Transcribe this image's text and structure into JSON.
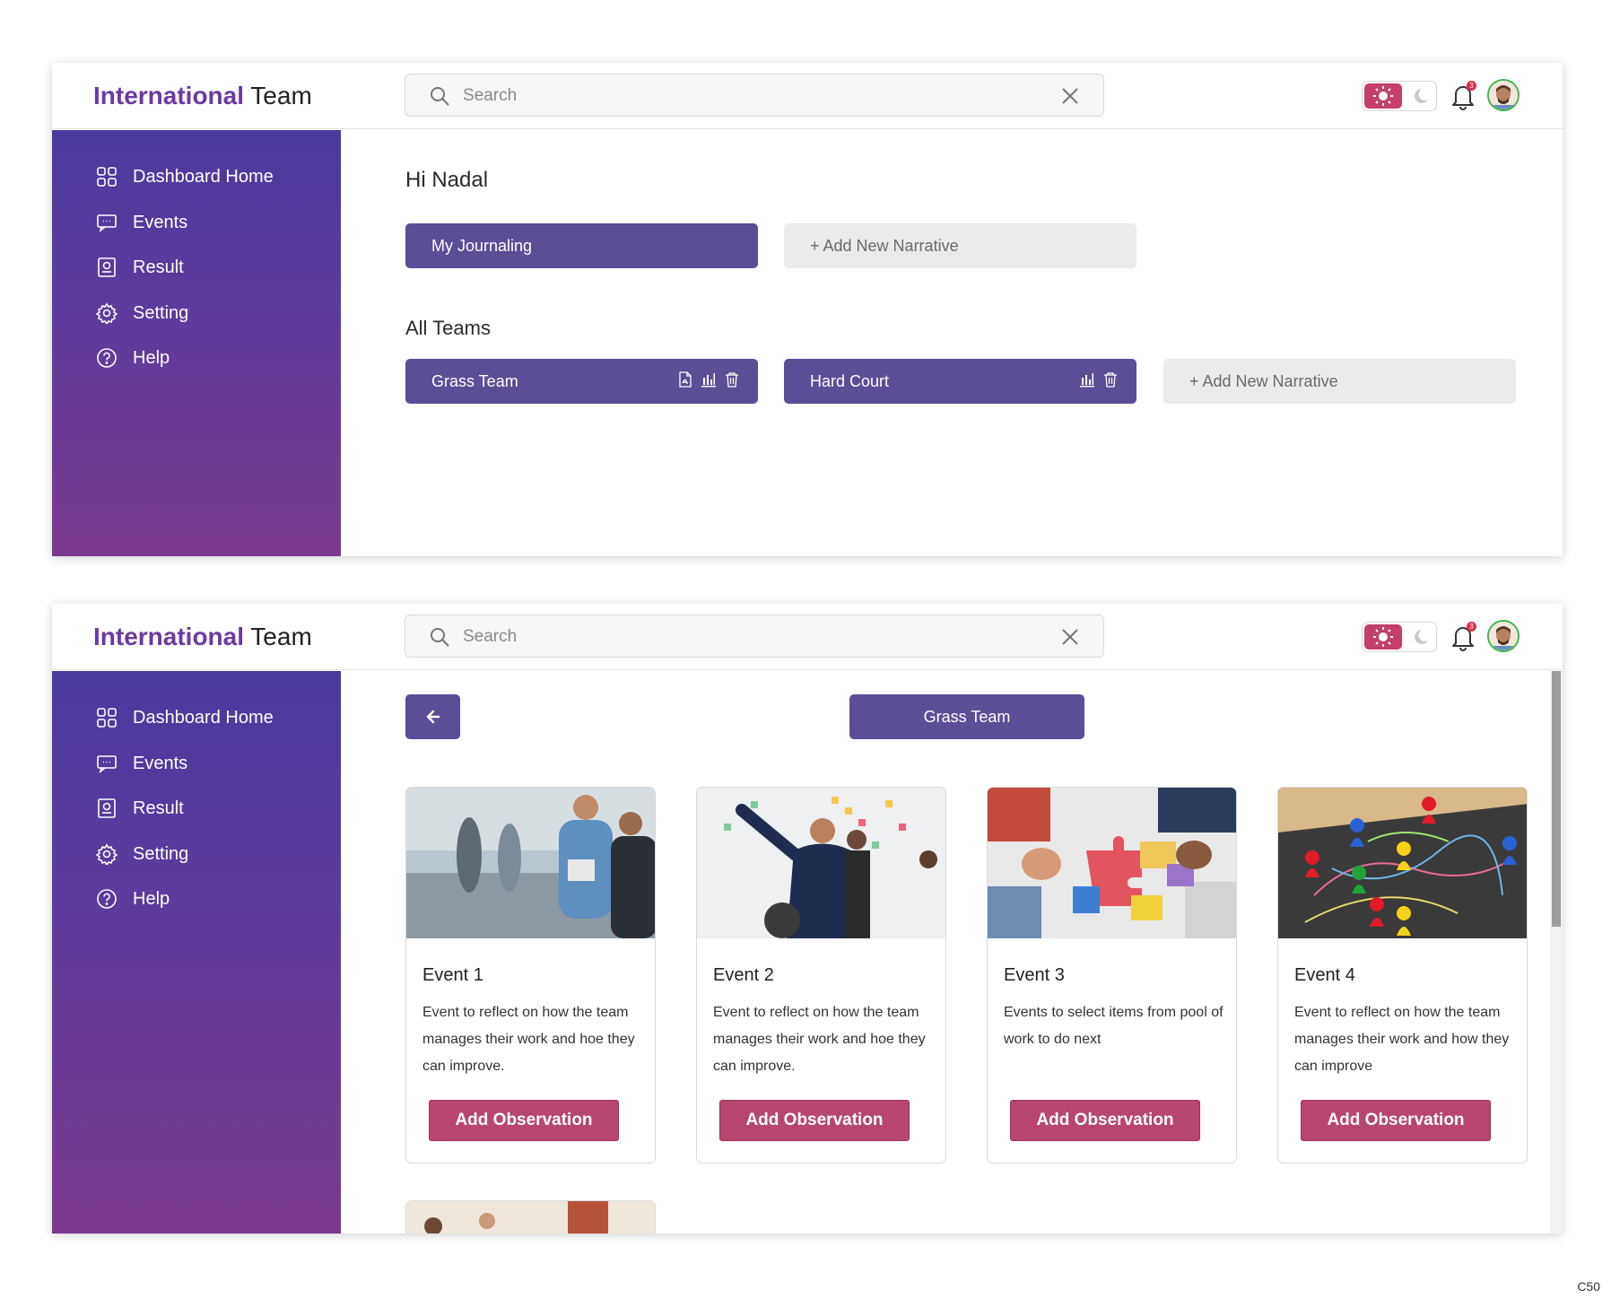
{
  "app": {
    "brand_part1": "International",
    "brand_part2": "Team"
  },
  "search": {
    "placeholder": "Search"
  },
  "topbar": {
    "notification_count": "3",
    "theme_mode": "light"
  },
  "sidebar": {
    "items": [
      {
        "label": "Dashboard Home",
        "icon": "grid-icon"
      },
      {
        "label": "Events",
        "icon": "chat-icon"
      },
      {
        "label": "Result",
        "icon": "report-icon"
      },
      {
        "label": "Setting",
        "icon": "gear-icon"
      },
      {
        "label": "Help",
        "icon": "help-icon"
      }
    ]
  },
  "dashboard": {
    "greeting": "Hi Nadal",
    "journal_button": "My Journaling",
    "add_narrative": "+ Add New Narrative",
    "all_teams_title": "All Teams",
    "teams": [
      {
        "name": "Grass Team",
        "actions": [
          "pdf-icon",
          "chart-icon",
          "trash-icon"
        ]
      },
      {
        "name": "Hard Court",
        "actions": [
          "chart-icon",
          "trash-icon"
        ]
      }
    ],
    "add_team_narrative": "+ Add New Narrative"
  },
  "team_view": {
    "team_title": "Grass Team",
    "events": [
      {
        "title": "Event 1",
        "description": "Event to reflect on how the team manages their work and hoe they can improve.",
        "button": "Add Observation"
      },
      {
        "title": "Event 2",
        "description": "Event to reflect on how the team manages their work and hoe they can improve.",
        "button": "Add Observation"
      },
      {
        "title": "Event 3",
        "description": "Events to select items from pool of work to do next",
        "button": "Add Observation"
      },
      {
        "title": "Event 4",
        "description": "Event to reflect on how the team manages their work and how they can improve",
        "button": "Add Observation"
      }
    ]
  },
  "colors": {
    "primary": "#5c4d97",
    "accent": "#b8456f",
    "sidebar_top": "#4c3a9e",
    "sidebar_bottom": "#7b3a8e"
  },
  "corner_label": "C50"
}
